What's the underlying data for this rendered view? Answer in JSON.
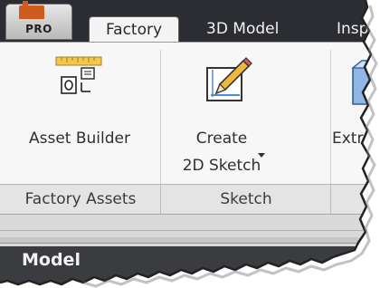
{
  "app_button": {
    "label": "PRO",
    "icon": "pro-app-icon"
  },
  "tabs": [
    {
      "label": "Factory",
      "active": true
    },
    {
      "label": "3D Model",
      "active": false
    },
    {
      "label": "Insp",
      "active": false
    }
  ],
  "ribbon": {
    "asset_builder": {
      "label": "Asset Builder",
      "icon": "asset-builder-icon"
    },
    "create_2d_sketch": {
      "label_line1": "Create",
      "label_line2": "2D Sketch",
      "icon": "create-2d-sketch-icon",
      "has_dropdown": true
    },
    "extrude": {
      "label": "Extrud",
      "icon": "extrude-icon"
    },
    "groups": [
      {
        "label": "Factory Assets"
      },
      {
        "label": "Sketch"
      }
    ]
  },
  "browser": {
    "title": "Model"
  },
  "colors": {
    "tabbar": "#2b2d32",
    "pro_logo": "#cf5b1f",
    "ruler": "#f2c94c",
    "sketch_accent": "#4a8ed1",
    "extrude_face": "#8fb6e6"
  }
}
